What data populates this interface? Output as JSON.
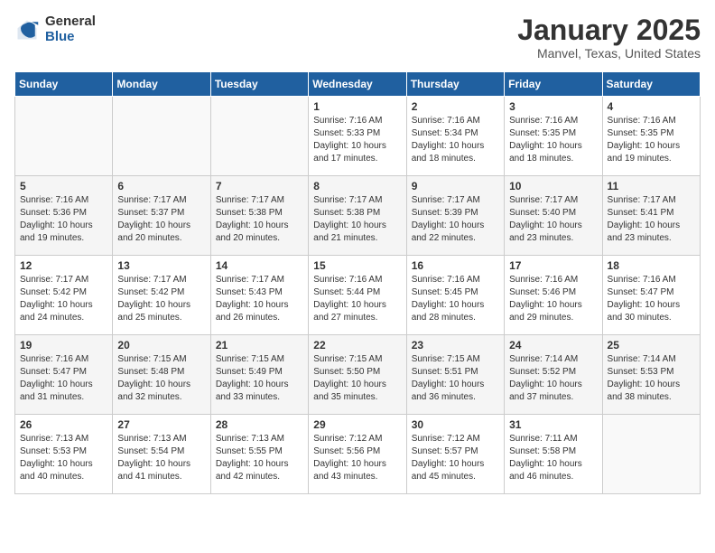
{
  "logo": {
    "general": "General",
    "blue": "Blue"
  },
  "header": {
    "month": "January 2025",
    "location": "Manvel, Texas, United States"
  },
  "weekdays": [
    "Sunday",
    "Monday",
    "Tuesday",
    "Wednesday",
    "Thursday",
    "Friday",
    "Saturday"
  ],
  "weeks": [
    [
      {
        "day": "",
        "info": ""
      },
      {
        "day": "",
        "info": ""
      },
      {
        "day": "",
        "info": ""
      },
      {
        "day": "1",
        "info": "Sunrise: 7:16 AM\nSunset: 5:33 PM\nDaylight: 10 hours\nand 17 minutes."
      },
      {
        "day": "2",
        "info": "Sunrise: 7:16 AM\nSunset: 5:34 PM\nDaylight: 10 hours\nand 18 minutes."
      },
      {
        "day": "3",
        "info": "Sunrise: 7:16 AM\nSunset: 5:35 PM\nDaylight: 10 hours\nand 18 minutes."
      },
      {
        "day": "4",
        "info": "Sunrise: 7:16 AM\nSunset: 5:35 PM\nDaylight: 10 hours\nand 19 minutes."
      }
    ],
    [
      {
        "day": "5",
        "info": "Sunrise: 7:16 AM\nSunset: 5:36 PM\nDaylight: 10 hours\nand 19 minutes."
      },
      {
        "day": "6",
        "info": "Sunrise: 7:17 AM\nSunset: 5:37 PM\nDaylight: 10 hours\nand 20 minutes."
      },
      {
        "day": "7",
        "info": "Sunrise: 7:17 AM\nSunset: 5:38 PM\nDaylight: 10 hours\nand 20 minutes."
      },
      {
        "day": "8",
        "info": "Sunrise: 7:17 AM\nSunset: 5:38 PM\nDaylight: 10 hours\nand 21 minutes."
      },
      {
        "day": "9",
        "info": "Sunrise: 7:17 AM\nSunset: 5:39 PM\nDaylight: 10 hours\nand 22 minutes."
      },
      {
        "day": "10",
        "info": "Sunrise: 7:17 AM\nSunset: 5:40 PM\nDaylight: 10 hours\nand 23 minutes."
      },
      {
        "day": "11",
        "info": "Sunrise: 7:17 AM\nSunset: 5:41 PM\nDaylight: 10 hours\nand 23 minutes."
      }
    ],
    [
      {
        "day": "12",
        "info": "Sunrise: 7:17 AM\nSunset: 5:42 PM\nDaylight: 10 hours\nand 24 minutes."
      },
      {
        "day": "13",
        "info": "Sunrise: 7:17 AM\nSunset: 5:42 PM\nDaylight: 10 hours\nand 25 minutes."
      },
      {
        "day": "14",
        "info": "Sunrise: 7:17 AM\nSunset: 5:43 PM\nDaylight: 10 hours\nand 26 minutes."
      },
      {
        "day": "15",
        "info": "Sunrise: 7:16 AM\nSunset: 5:44 PM\nDaylight: 10 hours\nand 27 minutes."
      },
      {
        "day": "16",
        "info": "Sunrise: 7:16 AM\nSunset: 5:45 PM\nDaylight: 10 hours\nand 28 minutes."
      },
      {
        "day": "17",
        "info": "Sunrise: 7:16 AM\nSunset: 5:46 PM\nDaylight: 10 hours\nand 29 minutes."
      },
      {
        "day": "18",
        "info": "Sunrise: 7:16 AM\nSunset: 5:47 PM\nDaylight: 10 hours\nand 30 minutes."
      }
    ],
    [
      {
        "day": "19",
        "info": "Sunrise: 7:16 AM\nSunset: 5:47 PM\nDaylight: 10 hours\nand 31 minutes."
      },
      {
        "day": "20",
        "info": "Sunrise: 7:15 AM\nSunset: 5:48 PM\nDaylight: 10 hours\nand 32 minutes."
      },
      {
        "day": "21",
        "info": "Sunrise: 7:15 AM\nSunset: 5:49 PM\nDaylight: 10 hours\nand 33 minutes."
      },
      {
        "day": "22",
        "info": "Sunrise: 7:15 AM\nSunset: 5:50 PM\nDaylight: 10 hours\nand 35 minutes."
      },
      {
        "day": "23",
        "info": "Sunrise: 7:15 AM\nSunset: 5:51 PM\nDaylight: 10 hours\nand 36 minutes."
      },
      {
        "day": "24",
        "info": "Sunrise: 7:14 AM\nSunset: 5:52 PM\nDaylight: 10 hours\nand 37 minutes."
      },
      {
        "day": "25",
        "info": "Sunrise: 7:14 AM\nSunset: 5:53 PM\nDaylight: 10 hours\nand 38 minutes."
      }
    ],
    [
      {
        "day": "26",
        "info": "Sunrise: 7:13 AM\nSunset: 5:53 PM\nDaylight: 10 hours\nand 40 minutes."
      },
      {
        "day": "27",
        "info": "Sunrise: 7:13 AM\nSunset: 5:54 PM\nDaylight: 10 hours\nand 41 minutes."
      },
      {
        "day": "28",
        "info": "Sunrise: 7:13 AM\nSunset: 5:55 PM\nDaylight: 10 hours\nand 42 minutes."
      },
      {
        "day": "29",
        "info": "Sunrise: 7:12 AM\nSunset: 5:56 PM\nDaylight: 10 hours\nand 43 minutes."
      },
      {
        "day": "30",
        "info": "Sunrise: 7:12 AM\nSunset: 5:57 PM\nDaylight: 10 hours\nand 45 minutes."
      },
      {
        "day": "31",
        "info": "Sunrise: 7:11 AM\nSunset: 5:58 PM\nDaylight: 10 hours\nand 46 minutes."
      },
      {
        "day": "",
        "info": ""
      }
    ]
  ]
}
